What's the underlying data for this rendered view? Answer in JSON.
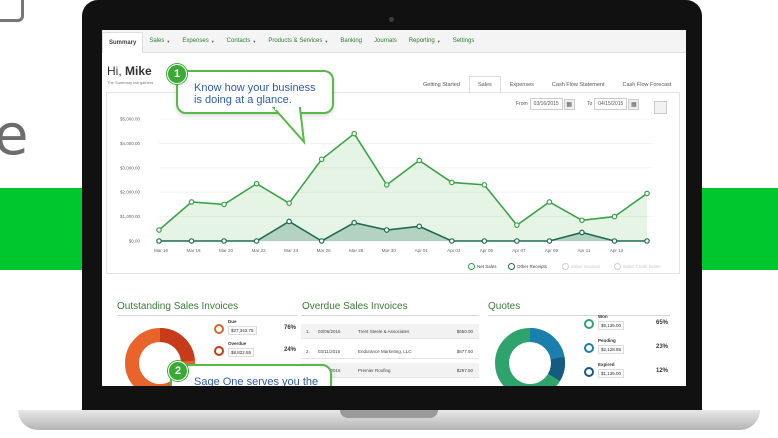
{
  "background": {
    "partial_word": "e",
    "band_color": "#00c72e"
  },
  "app": {
    "nav": [
      {
        "label": "Summary",
        "caret": false,
        "active": true
      },
      {
        "label": "Sales",
        "caret": true
      },
      {
        "label": "Expenses",
        "caret": true
      },
      {
        "label": "Contacts",
        "caret": true
      },
      {
        "label": "Products & Services",
        "caret": true
      },
      {
        "label": "Banking",
        "caret": false
      },
      {
        "label": "Journals",
        "caret": false
      },
      {
        "label": "Reporting",
        "caret": true
      },
      {
        "label": "Settings",
        "caret": false
      }
    ],
    "greeting_prefix": "Hi,",
    "greeting_name": "Mike",
    "subtitle": "The Summary tab gathers",
    "tabs": [
      "Getting Started",
      "Sales",
      "Expenses",
      "Cash Flow Statement",
      "Cash Flow Forecast"
    ],
    "active_tab": "Sales",
    "date_from_label": "From",
    "date_from": "03/16/2015",
    "date_to_label": "To",
    "date_to": "04/15/2015",
    "accent": "#3aaa35"
  },
  "chart_data": {
    "type": "area",
    "categories": [
      "Mar 16",
      "Mar 18",
      "Mar 20",
      "Mar 22",
      "Mar 24",
      "Mar 26",
      "Mar 28",
      "Mar 30",
      "Apr 01",
      "Apr 03",
      "Apr 05",
      "Apr 07",
      "Apr 09",
      "Apr 11",
      "Apr 13"
    ],
    "y_ticks": [
      "$5,000.00",
      "$4,000.00",
      "$3,000.00",
      "$2,000.00",
      "$1,000.00",
      "$0.00"
    ],
    "ylim": [
      0,
      5000
    ],
    "series": [
      {
        "name": "Net Sales",
        "color": "#3aa348",
        "values": [
          450,
          1600,
          1500,
          2350,
          1550,
          3350,
          4400,
          2300,
          3300,
          2400,
          2300,
          650,
          1600,
          850,
          1000,
          1950
        ]
      },
      {
        "name": "Other Receipts",
        "color": "#1e6b55",
        "values": [
          0,
          0,
          0,
          0,
          800,
          0,
          750,
          450,
          600,
          0,
          0,
          0,
          0,
          350,
          0,
          0
        ]
      }
    ],
    "x_points": 16,
    "legend": [
      {
        "label": "Net Sales",
        "active": true
      },
      {
        "label": "Other Receipts",
        "active": true
      },
      {
        "label": "Sales Invoices",
        "active": false
      },
      {
        "label": "Sales Credit Notes",
        "active": false
      }
    ]
  },
  "sections": {
    "outstanding": {
      "title": "Outstanding Sales Invoices",
      "stats": [
        {
          "label": "Due",
          "amount": "$27,343.75",
          "percent": "76%"
        },
        {
          "label": "Overdue",
          "amount": "$8,822.55",
          "percent": "24%"
        }
      ]
    },
    "overdue": {
      "title": "Overdue Sales Invoices",
      "rows": [
        {
          "n": "1.",
          "date": "03/06/2015",
          "customer": "Trent Steele & Associates",
          "amount": "$650.00"
        },
        {
          "n": "2.",
          "date": "03/11/2015",
          "customer": "Endurance Marketing, LLC",
          "amount": "$877.50"
        },
        {
          "n": "3.",
          "date": "03/06/2015",
          "customer": "Premier Roofing",
          "amount": "$297.50"
        }
      ]
    },
    "quotes": {
      "title": "Quotes",
      "stats": [
        {
          "label": "Won",
          "amount": "$5,135.00",
          "percent": "65%"
        },
        {
          "label": "Pending",
          "amount": "$2,128.85",
          "percent": "23%"
        },
        {
          "label": "Expired",
          "amount": "$1,135.00",
          "percent": "12%"
        }
      ]
    }
  },
  "callouts": [
    {
      "number": "1",
      "text": "Know how your business is doing at a glance."
    },
    {
      "number": "2",
      "text": "Sage One serves you the"
    }
  ]
}
